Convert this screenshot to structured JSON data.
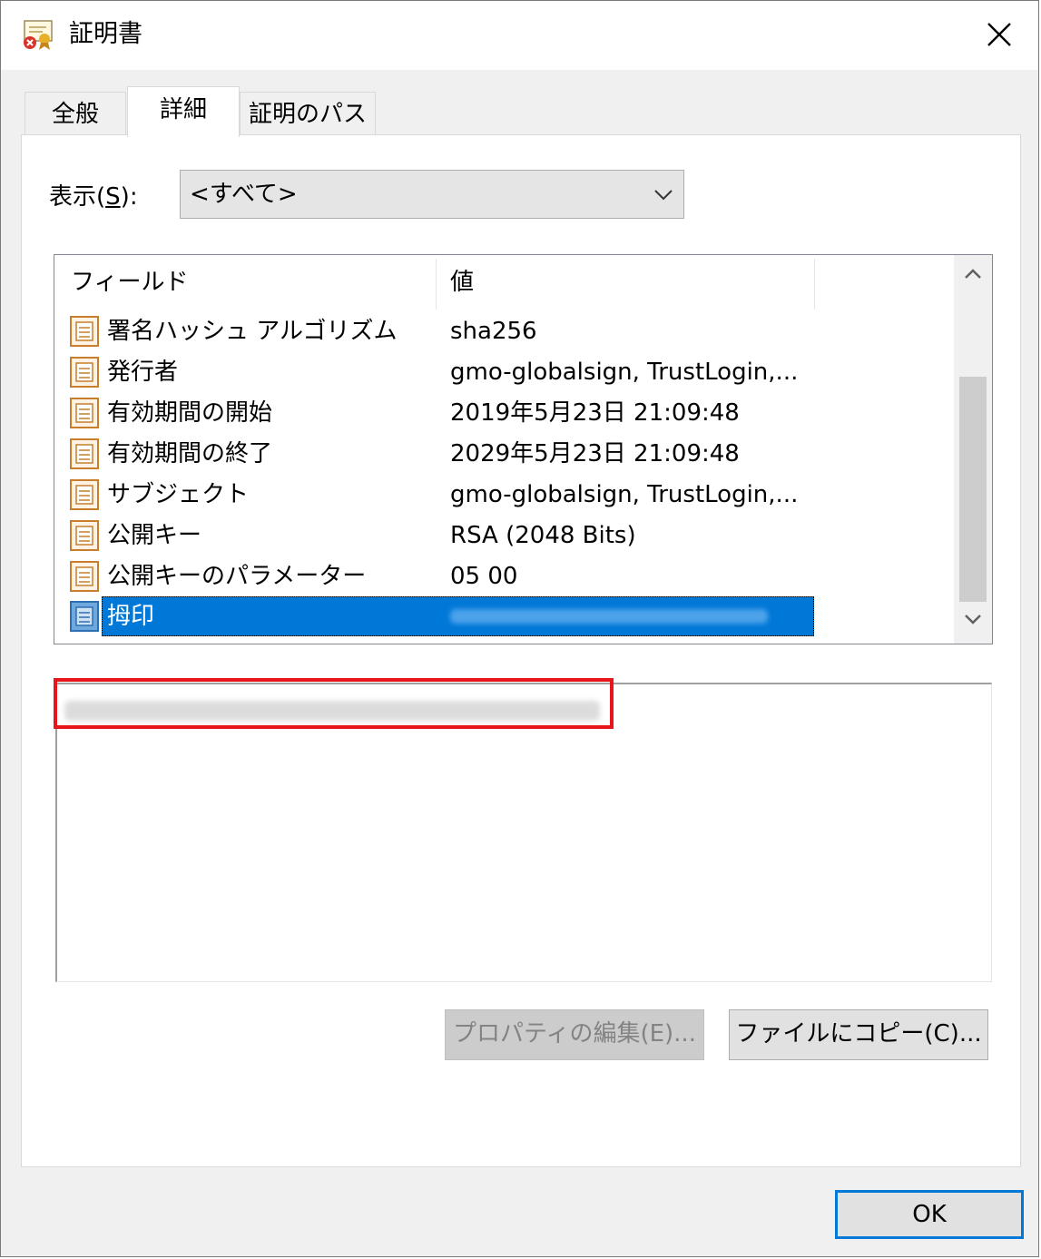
{
  "window": {
    "title": "証明書",
    "icon": "certificate-warning-icon",
    "close_glyph": "✕"
  },
  "tabs": [
    {
      "label": "全般",
      "active": false
    },
    {
      "label": "詳細",
      "active": true
    },
    {
      "label": "証明のパス",
      "active": false
    }
  ],
  "show": {
    "label_prefix": "表示(",
    "label_key": "S",
    "label_suffix": "):",
    "selected": "<すべて>"
  },
  "table": {
    "headers": [
      "フィールド",
      "値"
    ],
    "rows": [
      {
        "field": "署名ハッシュ アルゴリズム",
        "value": "sha256"
      },
      {
        "field": "発行者",
        "value": "gmo-globalsign, TrustLogin,..."
      },
      {
        "field": "有効期間の開始",
        "value": "2019年5月23日 21:09:48"
      },
      {
        "field": "有効期間の終了",
        "value": "2029年5月23日 21:09:48"
      },
      {
        "field": "サブジェクト",
        "value": "gmo-globalsign, TrustLogin,..."
      },
      {
        "field": "公開キー",
        "value": "RSA (2048 Bits)"
      },
      {
        "field": "公開キーのパラメーター",
        "value": "05 00"
      },
      {
        "field": "拇印",
        "value": "",
        "selected": true
      }
    ]
  },
  "buttons": {
    "edit_properties": "プロパティの編集(E)...",
    "copy_to_file": "ファイルにコピー(C)...",
    "ok": "OK"
  },
  "colors": {
    "selection": "#0078d7",
    "highlight_box": "#e8151b",
    "ok_border": "#0078d7"
  }
}
